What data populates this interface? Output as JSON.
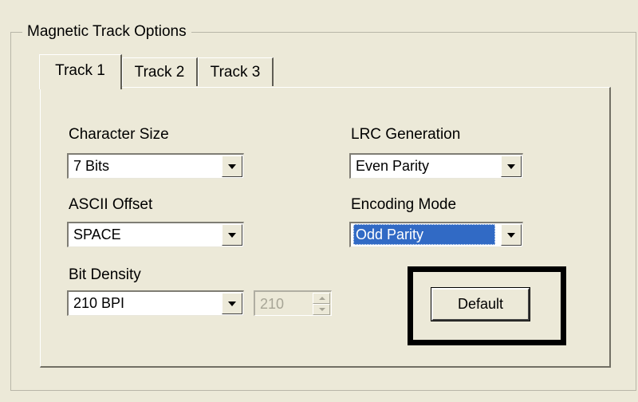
{
  "group_title": "Magnetic Track Options",
  "tabs": [
    {
      "label": "Track 1",
      "active": true
    },
    {
      "label": "Track 2",
      "active": false
    },
    {
      "label": "Track 3",
      "active": false
    }
  ],
  "fields": {
    "character_size": {
      "label": "Character Size",
      "value": "7 Bits"
    },
    "ascii_offset": {
      "label": "ASCII Offset",
      "value": "SPACE"
    },
    "bit_density": {
      "label": "Bit Density",
      "value": "210 BPI",
      "spin_value": "210"
    },
    "lrc_generation": {
      "label": "LRC Generation",
      "value": "Even Parity"
    },
    "encoding_mode": {
      "label": "Encoding Mode",
      "value": "Odd Parity"
    }
  },
  "default_button_label": "Default",
  "colors": {
    "window_bg": "#ece9d8",
    "selection": "#316ac5"
  }
}
